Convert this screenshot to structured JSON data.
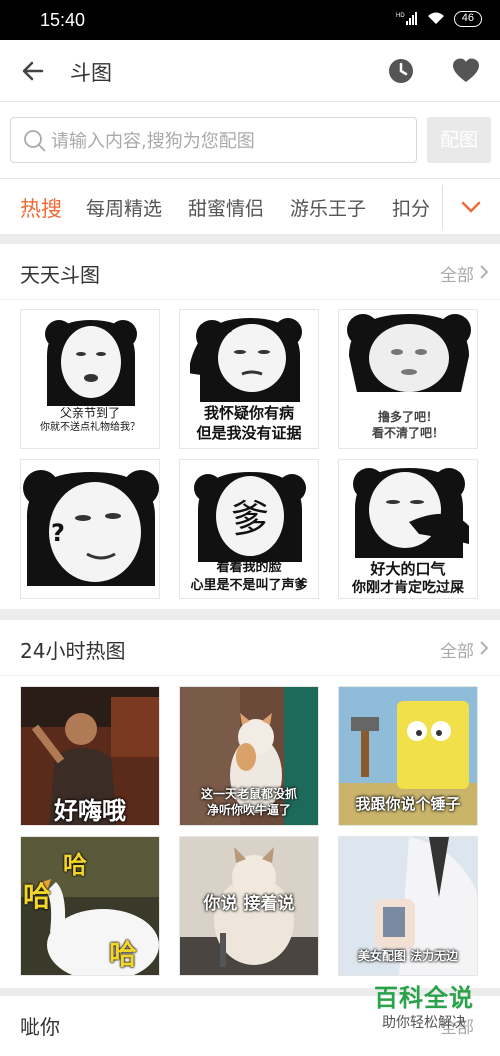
{
  "status": {
    "time": "15:40",
    "signal": "HD",
    "battery": "46"
  },
  "appbar": {
    "title": "斗图",
    "icons": [
      "back-arrow-icon",
      "history-clock-icon",
      "favorite-heart-icon"
    ]
  },
  "search": {
    "placeholder": "请输入内容,搜狗为您配图",
    "button": "配图"
  },
  "tabs": [
    "热搜",
    "每周精选",
    "甜蜜情侣",
    "游乐王子",
    "扣分"
  ],
  "colors": {
    "accent": "#f06b34",
    "watermark": "#2aa24a"
  },
  "sections": [
    {
      "title": "天天斗图",
      "more": "全部",
      "items": [
        {
          "caption": [
            "父亲节到了",
            "你就不送点礼物给我？"
          ]
        },
        {
          "caption": [
            "我怀疑你有病",
            "但是我没有证据"
          ]
        },
        {
          "caption": [
            "撸多了吧！",
            "看不清了吧！"
          ]
        },
        {
          "caption": [
            "?"
          ]
        },
        {
          "caption": [
            "看着我的脸",
            "心里是不是叫了声爹"
          ],
          "mark": "爹"
        },
        {
          "caption": [
            "好大的口气",
            "你刚才肯定吃过屎"
          ]
        }
      ]
    },
    {
      "title": "24小时热图",
      "more": "全部",
      "items": [
        {
          "caption": [
            "好嗨哦"
          ]
        },
        {
          "caption": [
            "这一天老鼠都没抓",
            "净听你吹牛逼了"
          ]
        },
        {
          "caption": [
            "我跟你说个锤子"
          ]
        },
        {
          "caption": [
            "哈",
            "哈",
            "哈"
          ]
        },
        {
          "caption": [
            "你说 接着说"
          ]
        },
        {
          "caption": [
            "美女配图 法力无边"
          ]
        }
      ]
    },
    {
      "title": "呲你",
      "more": "全部"
    }
  ],
  "watermark": {
    "title": "百科全说",
    "subtitle": "助你轻松解决"
  }
}
